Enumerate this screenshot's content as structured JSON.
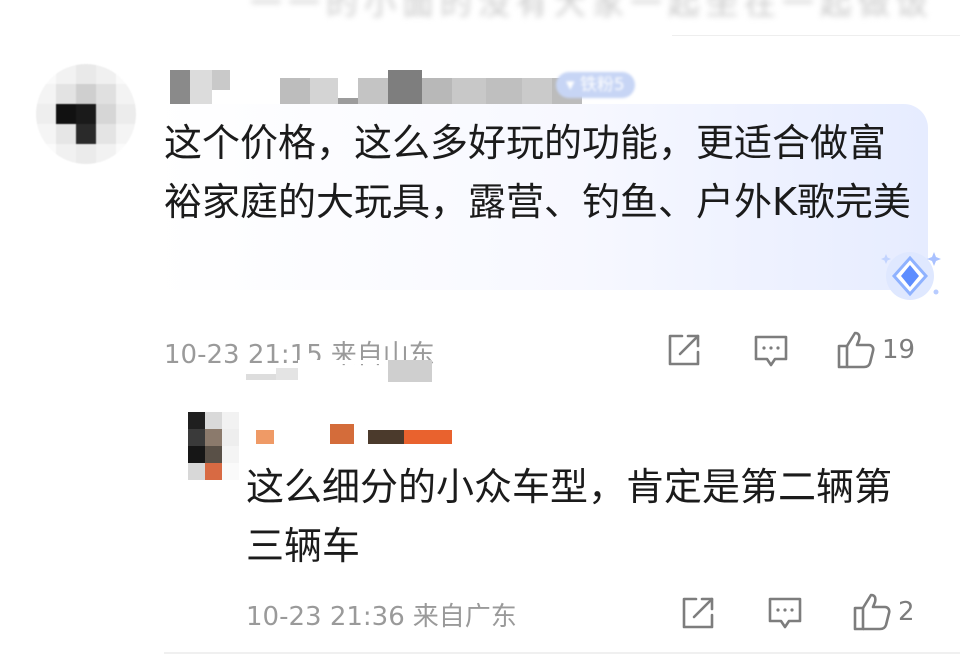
{
  "top_fragment": "一一的小面的没有大家一起坐在一起做饭",
  "comments": [
    {
      "badge": "铁粉5",
      "text": "这个价格，这么多好玩的功能，更适合做富裕家庭的大玩具，露营、钓鱼、户外K歌完美",
      "time": "10-23 21:15",
      "location": "来自山东",
      "likes": "19"
    },
    {
      "text": "这么细分的小众车型，肯定是第二辆第三辆车",
      "time": "10-23 21:36",
      "location": "来自广东",
      "likes": "2"
    }
  ],
  "icons": {
    "share": "share-icon",
    "reply": "comment-icon",
    "like": "thumbs-up-icon"
  },
  "colors": {
    "text": "#1b1b1b",
    "meta": "#9a9a9a",
    "bubble_highlight": "#e6ecff",
    "badge": "#c7d5f5"
  }
}
